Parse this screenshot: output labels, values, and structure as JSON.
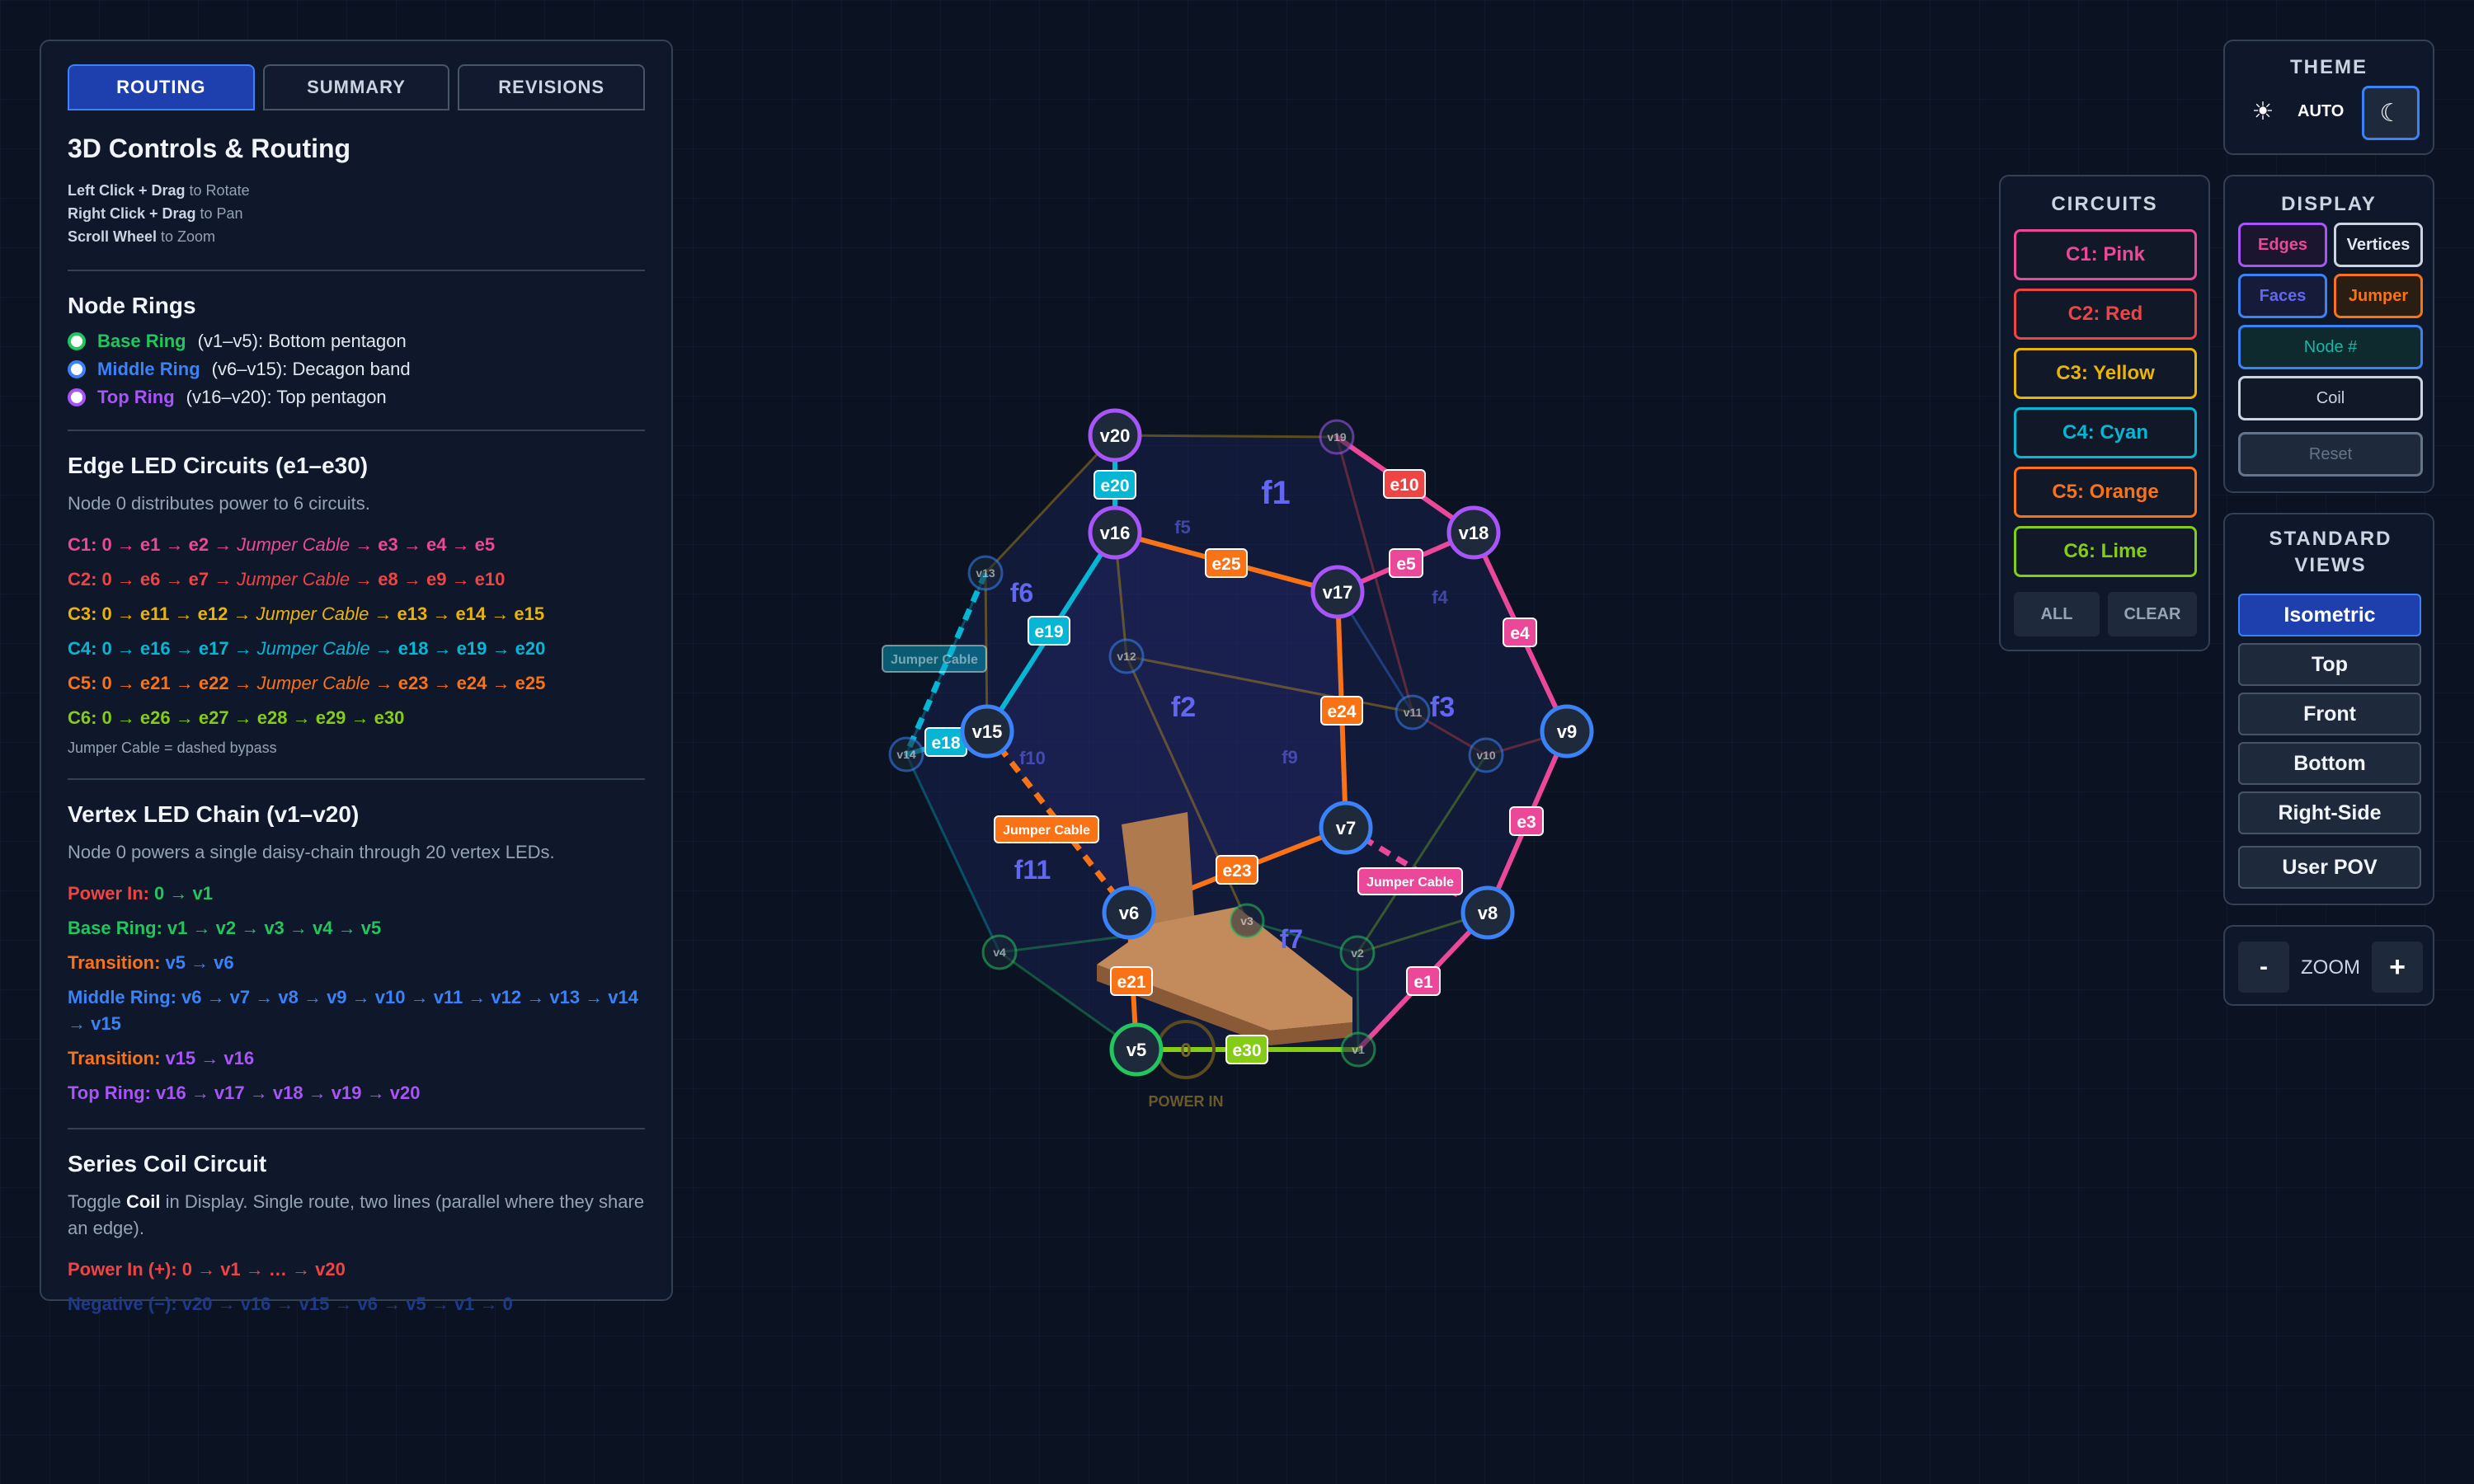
{
  "tabs": [
    "ROUTING",
    "SUMMARY",
    "REVISIONS"
  ],
  "info": {
    "title": "3D Controls & Routing",
    "hints": [
      {
        "bold": "Left Click + Drag",
        "rest": " to Rotate"
      },
      {
        "bold": "Right Click + Drag",
        "rest": " to Pan"
      },
      {
        "bold": "Scroll Wheel",
        "rest": " to Zoom"
      }
    ],
    "rings_title": "Node Rings",
    "rings": [
      {
        "name": "Base Ring",
        "desc": "(v1–v5): Bottom pentagon",
        "color": "#22c55e"
      },
      {
        "name": "Middle Ring",
        "desc": "(v6–v15): Decagon band",
        "color": "#3b82f6"
      },
      {
        "name": "Top Ring",
        "desc": "(v16–v20): Top pentagon",
        "color": "#a855f7"
      }
    ],
    "edge_title": "Edge LED Circuits (e1–e30)",
    "edge_desc": "Node 0 distributes power to 6 circuits.",
    "circuits": [
      {
        "label": "C1:",
        "pre": "0 → e1 → e2 →",
        "jumper": "Jumper Cable",
        "post": "→ e3 → e4 → e5",
        "color": "#ec4899"
      },
      {
        "label": "C2:",
        "pre": "0 → e6 → e7 →",
        "jumper": "Jumper Cable",
        "post": "→ e8 → e9 → e10",
        "color": "#ef4444"
      },
      {
        "label": "C3:",
        "pre": "0 → e11 → e12 →",
        "jumper": "Jumper Cable",
        "post": "→ e13 → e14 → e15",
        "color": "#eab308"
      },
      {
        "label": "C4:",
        "pre": "0 → e16 → e17 →",
        "jumper": "Jumper Cable",
        "post": "→ e18 → e19 → e20",
        "color": "#06b6d4"
      },
      {
        "label": "C5:",
        "pre": "0 → e21 → e22 →",
        "jumper": "Jumper Cable",
        "post": "→ e23 → e24 → e25",
        "color": "#f97316"
      },
      {
        "label": "C6:",
        "pre": "0 → e26 → e27 → e28 → e29 → e30",
        "jumper": "",
        "post": "",
        "color": "#84cc16"
      }
    ],
    "jumper_note": "Jumper Cable = dashed bypass",
    "vertex_title": "Vertex LED Chain (v1–v20)",
    "vertex_desc": "Node 0 powers a single daisy-chain through 20 vertex LEDs.",
    "chain": [
      {
        "label": "Power In:",
        "text": "0 → v1",
        "color": "#ef4444",
        "text_color": "#22c55e"
      },
      {
        "label": "Base Ring:",
        "text": "v1 → v2 → v3 → v4 → v5",
        "color": "#22c55e",
        "text_color": "#22c55e"
      },
      {
        "label": "Transition:",
        "text": "v5 → v6",
        "color": "#f97316",
        "text_color": "#3b82f6"
      },
      {
        "label": "Middle Ring:",
        "text": "v6 → v7 → v8 → v9 → v10 → v11 → v12 → v13 → v14 → v15",
        "color": "#3b82f6",
        "text_color": "#3b82f6"
      },
      {
        "label": "Transition:",
        "text": "v15 → v16",
        "color": "#f97316",
        "text_color": "#a855f7"
      },
      {
        "label": "Top Ring:",
        "text": "v16 → v17 → v18 → v19 → v20",
        "color": "#a855f7",
        "text_color": "#a855f7"
      }
    ],
    "coil_title": "Series Coil Circuit",
    "coil_desc_pre": "Toggle ",
    "coil_desc_bold": "Coil",
    "coil_desc_post": " in Display. Single route, two lines (parallel where they share an edge).",
    "coil_pos": "Power In (+): 0 → v1 → … → v20",
    "coil_neg": "Negative (−): v20 → v16 → v15 → v6 → v5 → v1 → 0"
  },
  "theme": {
    "title": "THEME",
    "auto": "AUTO",
    "sun": "☀",
    "moon": "☾"
  },
  "circuits_panel": {
    "title": "CIRCUITS",
    "items": [
      {
        "label": "C1: Pink",
        "color": "#ec4899"
      },
      {
        "label": "C2: Red",
        "color": "#ef4444"
      },
      {
        "label": "C3: Yellow",
        "color": "#eab308"
      },
      {
        "label": "C4: Cyan",
        "color": "#06b6d4"
      },
      {
        "label": "C5: Orange",
        "color": "#f97316"
      },
      {
        "label": "C6: Lime",
        "color": "#84cc16"
      }
    ],
    "all": "ALL",
    "clear": "CLEAR"
  },
  "display_panel": {
    "title": "DISPLAY",
    "edges": "Edges",
    "vertices": "Vertices",
    "faces": "Faces",
    "jumper": "Jumper",
    "node": "Node #",
    "coil": "Coil",
    "reset": "Reset"
  },
  "views_panel": {
    "title": "STANDARD VIEWS",
    "items": [
      "Isometric",
      "Top",
      "Front",
      "Bottom",
      "Right-Side",
      "User POV"
    ]
  },
  "zoom": {
    "label": "ZOOM",
    "minus": "-",
    "plus": "+"
  },
  "graph": {
    "power_in": "POWER IN",
    "node0": "0",
    "jumper_label": "Jumper Cable",
    "faces": [
      "f1",
      "f2",
      "f3",
      "f4",
      "f5",
      "f6",
      "f7",
      "f9",
      "f10",
      "f11"
    ]
  }
}
